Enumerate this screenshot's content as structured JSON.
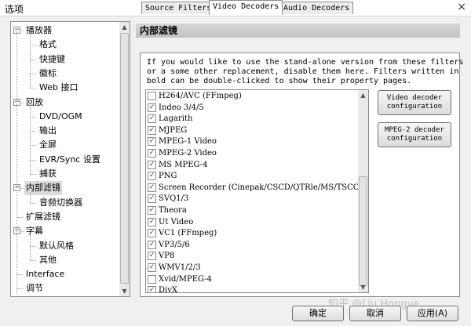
{
  "window": {
    "title": "选项",
    "close_glyph": "×"
  },
  "tree": {
    "items": [
      {
        "label": "播放器",
        "level": 0,
        "expand": "−"
      },
      {
        "label": "格式",
        "level": 1
      },
      {
        "label": "快捷键",
        "level": 1
      },
      {
        "label": "徽标",
        "level": 1
      },
      {
        "label": "Web 接口",
        "level": 1
      },
      {
        "label": "回放",
        "level": 0,
        "expand": "−"
      },
      {
        "label": "DVD/OGM",
        "level": 1
      },
      {
        "label": "输出",
        "level": 1
      },
      {
        "label": "全屏",
        "level": 1
      },
      {
        "label": "EVR/Sync 设置",
        "level": 1
      },
      {
        "label": "捕获",
        "level": 1
      },
      {
        "label": "内部滤镜",
        "level": 0,
        "expand": "−",
        "selected": true
      },
      {
        "label": "音频切换器",
        "level": 1
      },
      {
        "label": "扩展滤镜",
        "level": 0
      },
      {
        "label": "字幕",
        "level": 0,
        "expand": "−"
      },
      {
        "label": "默认风格",
        "level": 1
      },
      {
        "label": "其他",
        "level": 1
      },
      {
        "label": "Interface",
        "level": 0
      },
      {
        "label": "调节",
        "level": 0
      }
    ]
  },
  "section_title": "内部滤镜",
  "tabs": [
    {
      "label": "Source Filters",
      "active": false
    },
    {
      "label": "Video Decoders",
      "active": true
    },
    {
      "label": "Audio Decoders",
      "active": false
    }
  ],
  "description_lines": [
    "If you would like to use the stand-alone version from these filters",
    "or a some other replacement, disable them here. Filters written in",
    "bold can be double-clicked to show their property pages."
  ],
  "filters": [
    {
      "label": "H264/AVC (FFmpeg)",
      "checked": false
    },
    {
      "label": "Indeo 3/4/5",
      "checked": true
    },
    {
      "label": "Lagarith",
      "checked": true
    },
    {
      "label": "MJPEG",
      "checked": true
    },
    {
      "label": "MPEG-1 Video",
      "checked": true
    },
    {
      "label": "MPEG-2 Video",
      "checked": true
    },
    {
      "label": "MS MPEG-4",
      "checked": true
    },
    {
      "label": "PNG",
      "checked": true
    },
    {
      "label": "Screen Recorder (Cinepak/CSCD/QTRle/MS/TSCC)",
      "checked": true
    },
    {
      "label": "SVQ1/3",
      "checked": true
    },
    {
      "label": "Theora",
      "checked": true
    },
    {
      "label": "Ut Video",
      "checked": true
    },
    {
      "label": "VC1 (FFmpeg)",
      "checked": true
    },
    {
      "label": "VP3/5/6",
      "checked": true
    },
    {
      "label": "VP8",
      "checked": true
    },
    {
      "label": "WMV1/2/3",
      "checked": true
    },
    {
      "label": "Xvid/MPEG-4",
      "checked": false
    },
    {
      "label": "DivX",
      "checked": true
    }
  ],
  "side_buttons": {
    "video_line1": "Video decoder",
    "video_line2": "configuration",
    "mpeg2_line1": "MPEG-2 decoder",
    "mpeg2_line2": "configuration"
  },
  "buttons": {
    "ok": "确定",
    "cancel": "取消",
    "apply": "应用(A)"
  },
  "watermark": "知乎 @Liu Hongye",
  "icons": {
    "check": "✓",
    "scroll_up": "▲",
    "scroll_down": "▼"
  }
}
